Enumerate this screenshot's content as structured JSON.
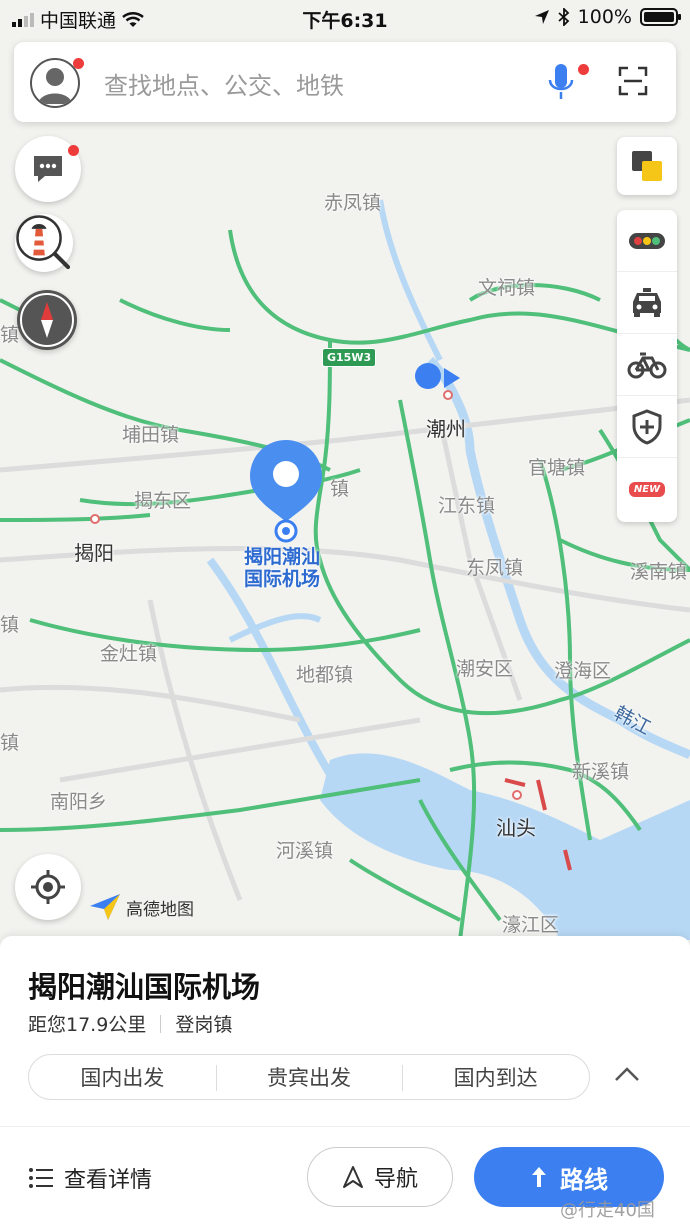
{
  "status_bar": {
    "carrier": "中国联通",
    "time": "下午6:31",
    "battery": "100%"
  },
  "search": {
    "placeholder": "查找地点、公交、地铁"
  },
  "map": {
    "highway_shield": "G15W3",
    "places": [
      {
        "name": "赤凤镇",
        "kind": "town"
      },
      {
        "name": "文祠镇",
        "kind": "town"
      },
      {
        "name": "潮州",
        "kind": "city"
      },
      {
        "name": "埔田镇",
        "kind": "town"
      },
      {
        "name": "揭东区",
        "kind": "town"
      },
      {
        "name": "镇",
        "kind": "town"
      },
      {
        "name": "官塘镇",
        "kind": "town"
      },
      {
        "name": "江东镇",
        "kind": "town"
      },
      {
        "name": "揭阳",
        "kind": "city"
      },
      {
        "name": "东凤镇",
        "kind": "town"
      },
      {
        "name": "溪南镇",
        "kind": "town"
      },
      {
        "name": "金灶镇",
        "kind": "town"
      },
      {
        "name": "地都镇",
        "kind": "town"
      },
      {
        "name": "潮安区",
        "kind": "town"
      },
      {
        "name": "澄海区",
        "kind": "town"
      },
      {
        "name": "韩江",
        "kind": "river"
      },
      {
        "name": "新溪镇",
        "kind": "town"
      },
      {
        "name": "南阳乡",
        "kind": "town"
      },
      {
        "name": "汕头",
        "kind": "city"
      },
      {
        "name": "河溪镇",
        "kind": "town"
      },
      {
        "name": "濠江区",
        "kind": "town"
      },
      {
        "name": "镇",
        "kind": "town"
      },
      {
        "name": "镇",
        "kind": "town"
      },
      {
        "name": "镇",
        "kind": "town"
      }
    ],
    "poi_label_line1": "揭阳潮汕",
    "poi_label_line2": "国际机场",
    "logo_text": "高德地图",
    "toolbar_new_badge": "NEW"
  },
  "sheet": {
    "title": "揭阳潮汕国际机场",
    "distance": "距您17.9公里",
    "area": "登岗镇",
    "tabs": [
      "国内出发",
      "贵宾出发",
      "国内到达"
    ],
    "details_label": "查看详情",
    "nav_label": "导航",
    "route_label": "路线"
  },
  "watermark": "@行走40国",
  "colors": {
    "accent": "#3b7ff0",
    "road": "#4fbf7a",
    "water": "#b7d8f5",
    "red_dot": "#ee3b3b"
  }
}
